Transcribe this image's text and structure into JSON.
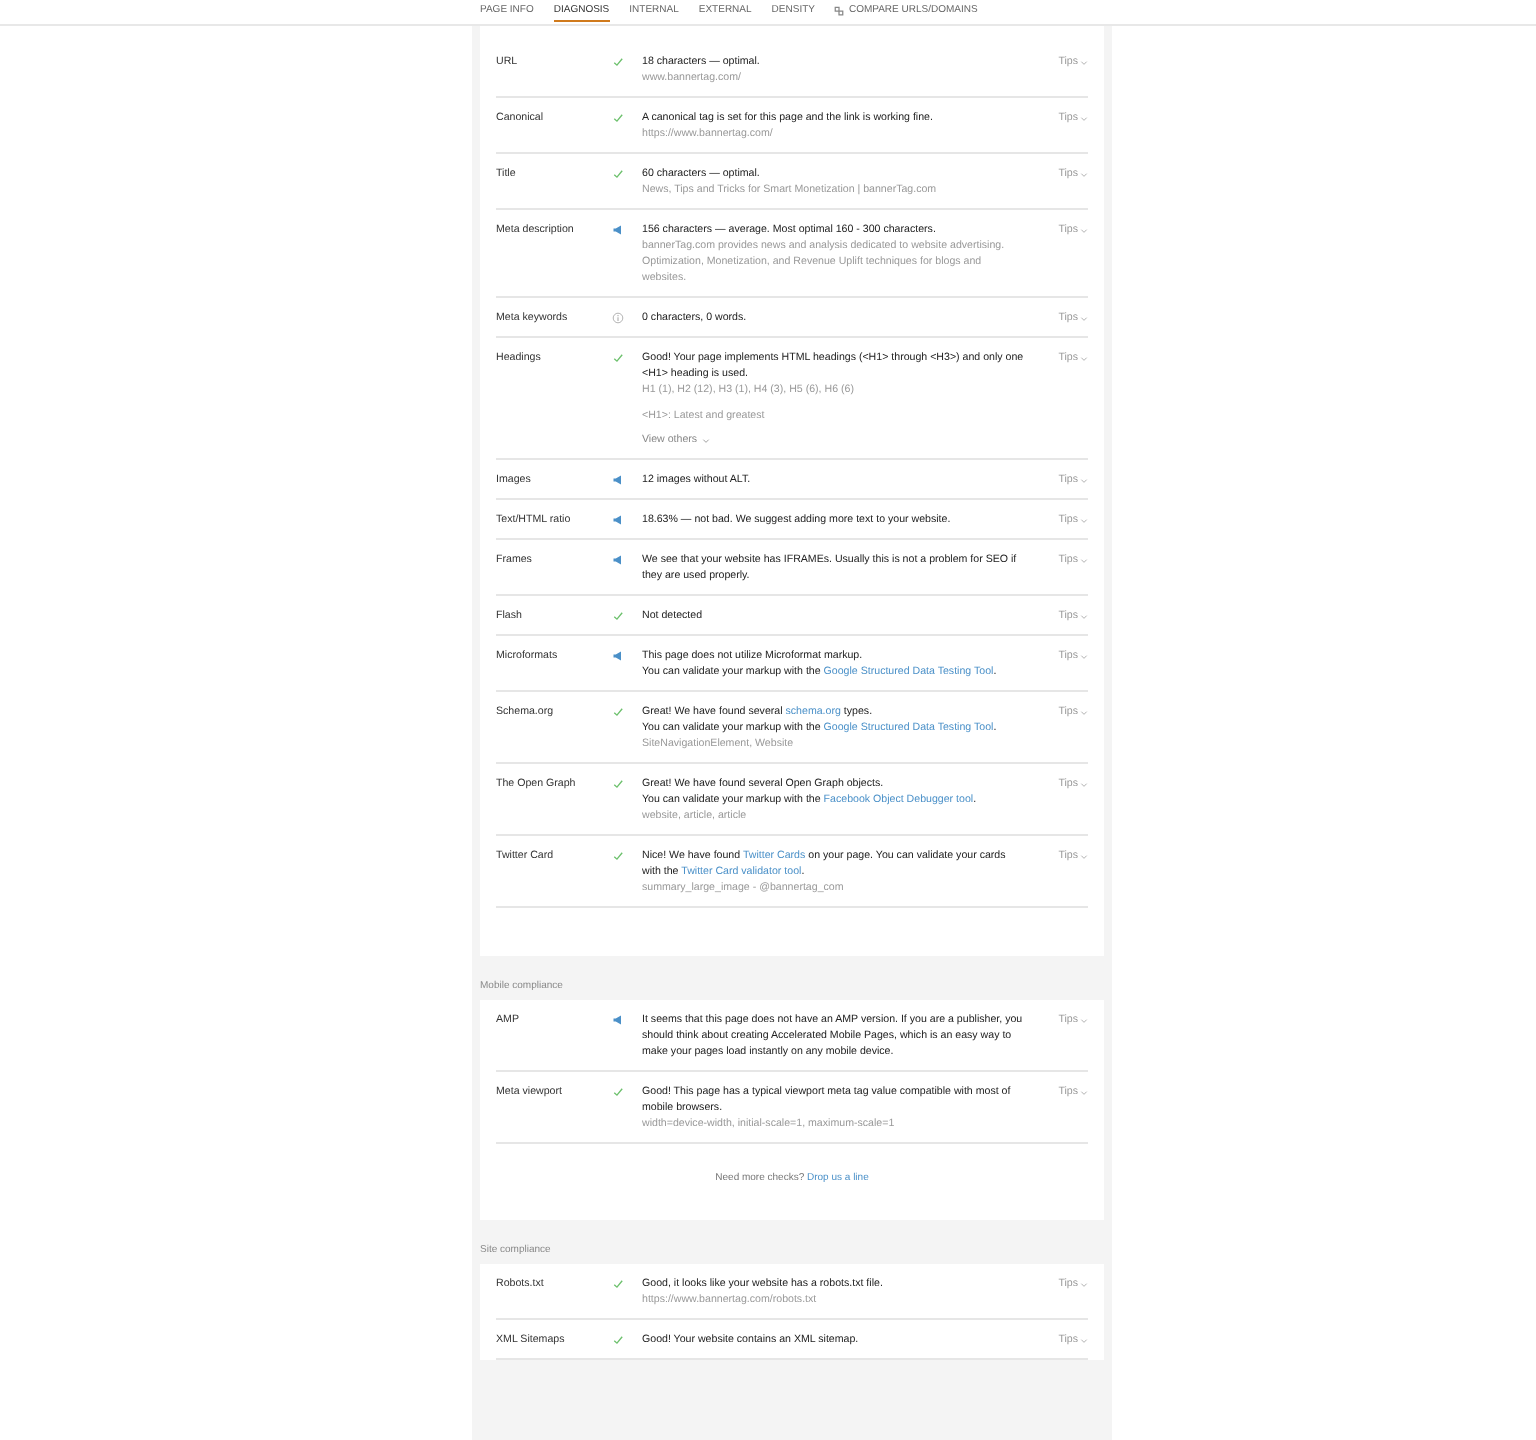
{
  "tabs": [
    {
      "label": "PAGE INFO",
      "selected": false,
      "icon": false
    },
    {
      "label": "DIAGNOSIS",
      "selected": true,
      "icon": false
    },
    {
      "label": "INTERNAL",
      "selected": false,
      "icon": false
    },
    {
      "label": "EXTERNAL",
      "selected": false,
      "icon": false
    },
    {
      "label": "DENSITY",
      "selected": false,
      "icon": false
    },
    {
      "label": "COMPARE URLS/DOMAINS",
      "selected": false,
      "icon": true
    }
  ],
  "sections": [
    {
      "rows": [
        {
          "label": "URL",
          "kind": "ok",
          "message": [
            [
              {
                "kind": "text",
                "text": "18 characters — optimal."
              }
            ]
          ],
          "details": [
            "www.bannertag.com/"
          ],
          "tips": "Tips"
        },
        {
          "label": "Canonical",
          "kind": "ok",
          "message": [
            [
              {
                "kind": "text",
                "text": "A canonical tag is set for this page and the link is working fine."
              }
            ]
          ],
          "details": [
            "https://www.bannertag.com/"
          ],
          "tips": "Tips"
        },
        {
          "label": "Title",
          "kind": "ok",
          "message": [
            [
              {
                "kind": "text",
                "text": "60 characters — optimal."
              }
            ]
          ],
          "details": [
            "News, Tips and Tricks for Smart Monetization | bannerTag.com"
          ],
          "tips": "Tips"
        },
        {
          "label": "Meta description",
          "kind": "warn",
          "message": [
            [
              {
                "kind": "text",
                "text": "156 characters — average. Most optimal 160 - 300 characters."
              }
            ]
          ],
          "details": [
            "bannerTag.com provides news and analysis dedicated to website advertising. Optimization, Monetization, and Revenue Uplift techniques for blogs and websites."
          ],
          "tips": "Tips"
        },
        {
          "label": "Meta keywords",
          "kind": "info",
          "message": [
            [
              {
                "kind": "text",
                "text": "0 characters, 0 words."
              }
            ]
          ],
          "tips": "Tips"
        },
        {
          "label": "Headings",
          "kind": "ok",
          "message": [
            [
              {
                "kind": "text",
                "text": "Good! Your page implements HTML headings (<H1> through <H3>) and only one <H1> heading is used."
              }
            ]
          ],
          "details": [
            "H1 (1), H2 (12), H3 (1), H4 (3), H5 (6), H6 (6)"
          ],
          "note": "<H1>: Latest and greatest",
          "more": "View others",
          "tips": "Tips"
        },
        {
          "label": "Images",
          "kind": "warn",
          "message": [
            [
              {
                "kind": "text",
                "text": "12 images without ALT."
              }
            ]
          ],
          "tips": "Tips"
        },
        {
          "label": "Text/HTML ratio",
          "kind": "warn",
          "message": [
            [
              {
                "kind": "text",
                "text": "18.63% — not bad. We suggest adding more text to your website."
              }
            ]
          ],
          "tips": "Tips"
        },
        {
          "label": "Frames",
          "kind": "warn",
          "message": [
            [
              {
                "kind": "text",
                "text": "We see that your website has IFRAMEs. Usually this is not a problem for SEO if they are used properly."
              }
            ]
          ],
          "tips": "Tips"
        },
        {
          "label": "Flash",
          "kind": "ok",
          "message": [
            [
              {
                "kind": "text",
                "text": "Not detected"
              }
            ]
          ],
          "tips": "Tips"
        },
        {
          "label": "Microformats",
          "kind": "warn",
          "message": [
            [
              {
                "kind": "text",
                "text": "This page does not utilize Microformat markup."
              }
            ],
            [
              {
                "kind": "text",
                "text": "You can validate your markup with the "
              },
              {
                "kind": "link",
                "text": "Google Structured Data Testing Tool"
              },
              {
                "kind": "text",
                "text": "."
              }
            ]
          ],
          "tips": "Tips"
        },
        {
          "label": "Schema.org",
          "kind": "ok",
          "message": [
            [
              {
                "kind": "text",
                "text": "Great! We have found several "
              },
              {
                "kind": "link",
                "text": "schema.org"
              },
              {
                "kind": "text",
                "text": " types."
              }
            ],
            [
              {
                "kind": "text",
                "text": "You can validate your markup with the "
              },
              {
                "kind": "link",
                "text": "Google Structured Data Testing Tool"
              },
              {
                "kind": "text",
                "text": "."
              }
            ]
          ],
          "details": [
            "SiteNavigationElement, Website"
          ],
          "tips": "Tips"
        },
        {
          "label": "The Open Graph",
          "kind": "ok",
          "message": [
            [
              {
                "kind": "text",
                "text": "Great! We have found several Open Graph objects."
              }
            ],
            [
              {
                "kind": "text",
                "text": "You can validate your markup with the "
              },
              {
                "kind": "link",
                "text": "Facebook Object Debugger tool"
              },
              {
                "kind": "text",
                "text": "."
              }
            ]
          ],
          "details": [
            "website, article, article"
          ],
          "tips": "Tips"
        },
        {
          "label": "Twitter Card",
          "kind": "ok",
          "message": [
            [
              {
                "kind": "text",
                "text": "Nice! We have found "
              },
              {
                "kind": "link",
                "text": "Twitter Cards"
              },
              {
                "kind": "text",
                "text": " on your page. You can validate your cards with the "
              },
              {
                "kind": "link",
                "text": "Twitter Card validator tool"
              },
              {
                "kind": "text",
                "text": "."
              }
            ]
          ],
          "details": [
            "summary_large_image - @bannertag_com"
          ],
          "tips": "Tips"
        }
      ]
    },
    {
      "title": "Mobile compliance",
      "rows": [
        {
          "label": "AMP",
          "kind": "warn",
          "message": [
            [
              {
                "kind": "text",
                "text": "It seems that this page does not have an AMP version. If you are a publisher, you should think about creating Accelerated Mobile Pages, which is an easy way to make your pages load instantly on any mobile device."
              }
            ]
          ],
          "tips": "Tips"
        },
        {
          "label": "Meta viewport",
          "kind": "ok",
          "message": [
            [
              {
                "kind": "text",
                "text": "Good! This page has a typical viewport meta tag value compatible with most of mobile browsers."
              }
            ]
          ],
          "details": [
            "width=device-width, initial-scale=1, maximum-scale=1"
          ],
          "tips": "Tips"
        }
      ],
      "footer": {
        "text": "Need more checks?",
        "link": "Drop us a line"
      }
    },
    {
      "title": "Site compliance",
      "rows": [
        {
          "label": "Robots.txt",
          "kind": "ok",
          "message": [
            [
              {
                "kind": "text",
                "text": "Good, it looks like your website has a robots.txt file."
              }
            ]
          ],
          "details": [
            "https://www.bannertag.com/robots.txt"
          ],
          "tips": "Tips"
        },
        {
          "label": "XML Sitemaps",
          "kind": "ok",
          "message": [
            [
              {
                "kind": "text",
                "text": "Good! Your website contains an XML sitemap."
              }
            ]
          ],
          "tips": "Tips"
        }
      ]
    }
  ]
}
